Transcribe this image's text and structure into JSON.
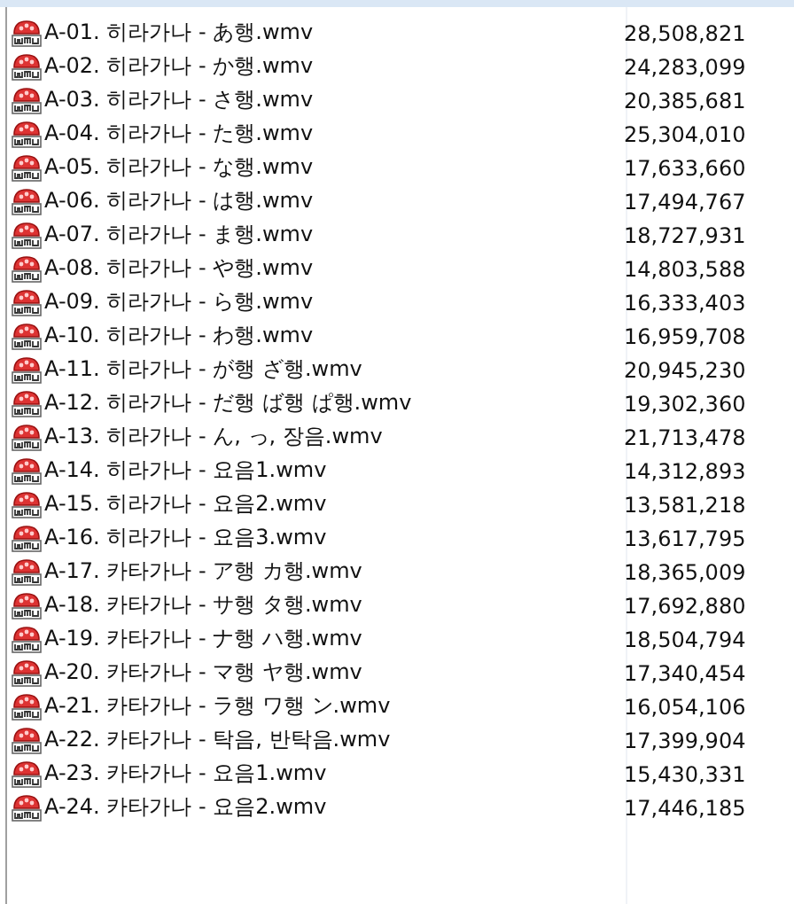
{
  "files": [
    {
      "name": "A-01. 히라가나 - あ행.wmv",
      "size": "28,508,821"
    },
    {
      "name": "A-02. 히라가나 - か행.wmv",
      "size": "24,283,099"
    },
    {
      "name": "A-03. 히라가나 - さ행.wmv",
      "size": "20,385,681"
    },
    {
      "name": "A-04. 히라가나 - た행.wmv",
      "size": "25,304,010"
    },
    {
      "name": "A-05. 히라가나 - な행.wmv",
      "size": "17,633,660"
    },
    {
      "name": "A-06. 히라가나 - は행.wmv",
      "size": "17,494,767"
    },
    {
      "name": "A-07. 히라가나 - ま행.wmv",
      "size": "18,727,931"
    },
    {
      "name": "A-08. 히라가나 - や행.wmv",
      "size": "14,803,588"
    },
    {
      "name": "A-09. 히라가나 - ら행.wmv",
      "size": "16,333,403"
    },
    {
      "name": "A-10. 히라가나 - わ행.wmv",
      "size": "16,959,708"
    },
    {
      "name": "A-11. 히라가나 - が행 ざ행.wmv",
      "size": "20,945,230"
    },
    {
      "name": "A-12. 히라가나 - だ행 ば행 ぱ행.wmv",
      "size": "19,302,360"
    },
    {
      "name": "A-13. 히라가나 - ん, っ, 장음.wmv",
      "size": "21,713,478"
    },
    {
      "name": "A-14. 히라가나 - 요음1.wmv",
      "size": "14,312,893"
    },
    {
      "name": "A-15. 히라가나 - 요음2.wmv",
      "size": "13,581,218"
    },
    {
      "name": "A-16. 히라가나 - 요음3.wmv",
      "size": "13,617,795"
    },
    {
      "name": "A-17. 카타가나 - ア행 カ행.wmv",
      "size": "18,365,009"
    },
    {
      "name": "A-18. 카타가나 - サ행 タ행.wmv",
      "size": "17,692,880"
    },
    {
      "name": "A-19. 카타가나 - ナ행 ハ행.wmv",
      "size": "18,504,794"
    },
    {
      "name": "A-20. 카타가나 - マ행 ヤ행.wmv",
      "size": "17,340,454"
    },
    {
      "name": "A-21. 카타가나 - ラ행 ワ행 ン.wmv",
      "size": "16,054,106"
    },
    {
      "name": "A-22. 카타가나 - 탁음, 반탁음.wmv",
      "size": "17,399,904"
    },
    {
      "name": "A-23. 카타가나 - 요음1.wmv",
      "size": "15,430,331"
    },
    {
      "name": "A-24. 카타가나 - 요음2.wmv",
      "size": "17,446,185"
    }
  ]
}
